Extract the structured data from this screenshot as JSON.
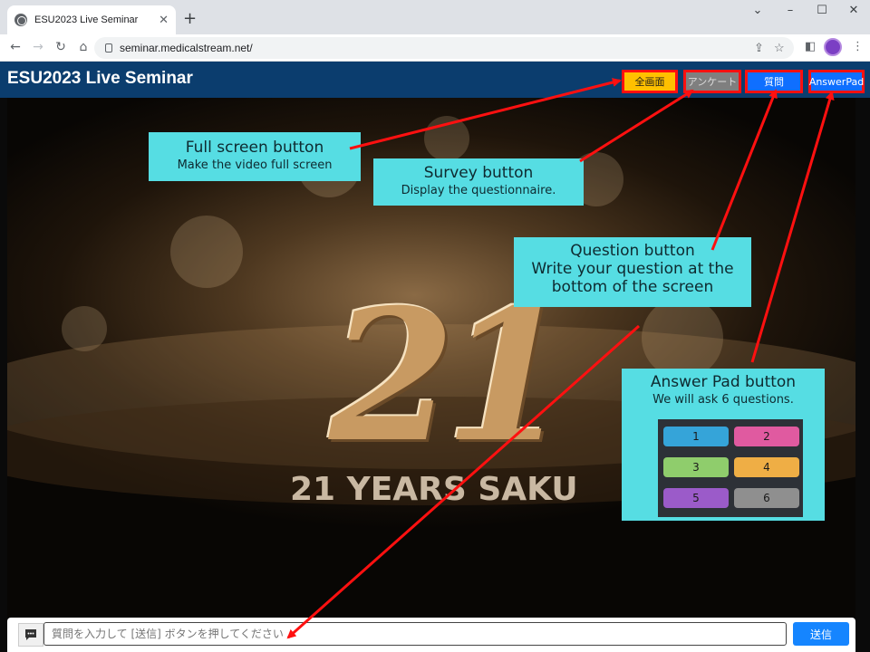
{
  "browser": {
    "tab_title": "ESU2023 Live Seminar",
    "new_tab": "+",
    "address": "seminar.medicalstream.net/",
    "window_controls": {
      "minimize": "–",
      "maximize": "☐",
      "close": "✕",
      "chevron": "⌄"
    }
  },
  "header": {
    "title": "ESU2023 Live Seminar",
    "buttons": {
      "fullscreen": "全画面",
      "survey": "アンケート",
      "question": "質問",
      "answerpad": "AnswerPad"
    }
  },
  "video": {
    "big_number": "21",
    "caption": "21 YEARS SAKU"
  },
  "callouts": {
    "fullscreen": {
      "title": "Full screen button",
      "desc": "Make the video full screen"
    },
    "survey": {
      "title": "Survey button",
      "desc": "Display the questionnaire."
    },
    "question": {
      "title": "Question button",
      "line2": "Write your question at the",
      "line3": "bottom of the screen"
    },
    "answerpad": {
      "title": "Answer Pad button",
      "desc": "We will ask 6 questions."
    }
  },
  "answer_pad": {
    "keys": [
      "1",
      "2",
      "3",
      "4",
      "5",
      "6"
    ],
    "colors": [
      "#35a4d9",
      "#e05aa0",
      "#8fcd6c",
      "#efae45",
      "#9b5bc9",
      "#8f8f8f"
    ]
  },
  "question_bar": {
    "placeholder": "質問を入力して [送信] ボタンを押してください",
    "send_label": "送信"
  },
  "colors": {
    "header_bg": "#0b3d6e",
    "callout_bg": "#56dde3",
    "fullscreen_btn": "#ffc000",
    "survey_btn": "#7f7f7f",
    "question_btn": "#0f6fff",
    "answerpad_btn": "#0f6fff",
    "send_btn": "#1585ff",
    "arrow": "#ff1010"
  }
}
